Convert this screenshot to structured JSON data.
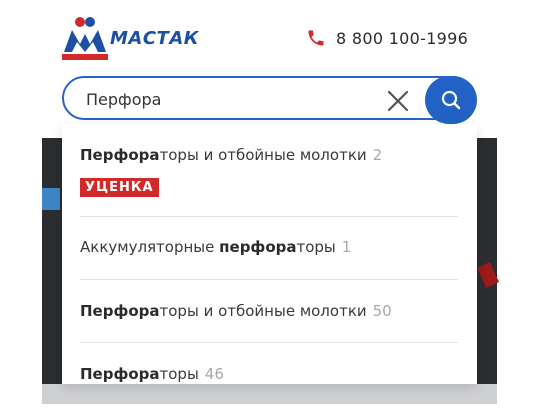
{
  "header": {
    "brand_name": "МАСТАК",
    "phone_number": "8 800 100-1996"
  },
  "search": {
    "value": "Перфора",
    "placeholder": ""
  },
  "suggestions": [
    {
      "bold": "Перфора",
      "rest": "торы и отбойные молотки",
      "prefix": "",
      "count": "2",
      "badge": "УЦЕНКА"
    },
    {
      "prefix": "Аккумуляторные ",
      "bold": "перфора",
      "rest": "торы",
      "count": "1"
    },
    {
      "prefix": "",
      "bold": "Перфора",
      "rest": "торы и отбойные молотки",
      "count": "50"
    },
    {
      "prefix": "",
      "bold": "Перфора",
      "rest": "торы",
      "count": "46"
    }
  ],
  "colors": {
    "brand_blue": "#1d4fa3",
    "search_blue": "#2162c4",
    "badge_red": "#d22a2a",
    "phone_red": "#d62b2b"
  },
  "icons": {
    "phone": "phone-icon",
    "clear": "close-icon",
    "search": "search-icon"
  }
}
